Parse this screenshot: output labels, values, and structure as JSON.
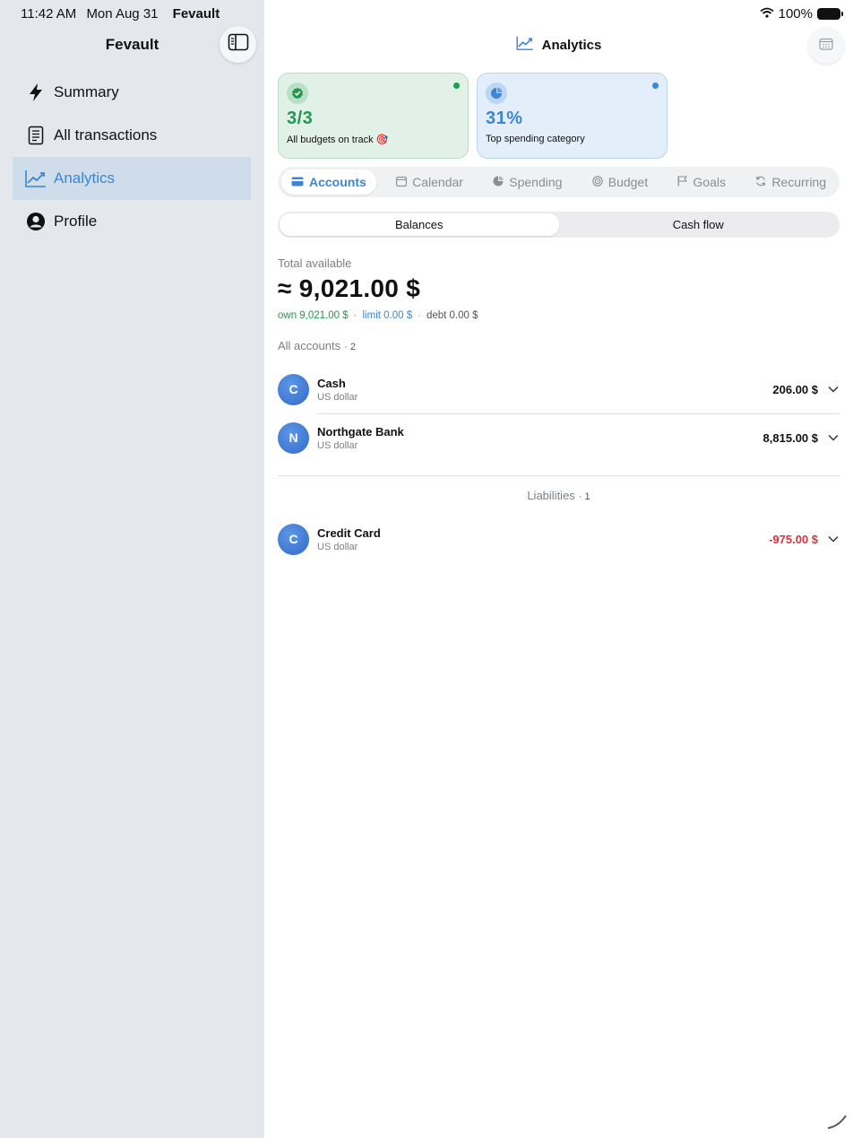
{
  "status": {
    "time": "11:42 AM",
    "date": "Mon Aug 31",
    "app_name": "Fevault",
    "battery": "100%"
  },
  "sidebar": {
    "title": "Fevault",
    "items": [
      {
        "label": "Summary",
        "icon": "bolt-icon"
      },
      {
        "label": "All transactions",
        "icon": "receipt-icon"
      },
      {
        "label": "Analytics",
        "icon": "chart-line-icon",
        "active": true
      },
      {
        "label": "Profile",
        "icon": "person-circle-icon"
      }
    ]
  },
  "header": {
    "title": "Analytics"
  },
  "cards": [
    {
      "value": "3/3",
      "label": "All budgets on track 🎯",
      "icon": "check-badge-icon",
      "color": "#1f9a4d"
    },
    {
      "value": "31%",
      "label": "Top spending category",
      "icon": "pie-chart-icon",
      "color": "#3d86d4"
    }
  ],
  "tabs": [
    {
      "label": "Accounts",
      "icon": "card-icon",
      "active": true
    },
    {
      "label": "Calendar",
      "icon": "calendar-icon"
    },
    {
      "label": "Spending",
      "icon": "pie-icon"
    },
    {
      "label": "Budget",
      "icon": "target-icon"
    },
    {
      "label": "Goals",
      "icon": "flag-icon"
    },
    {
      "label": "Recurring",
      "icon": "repeat-icon"
    }
  ],
  "segments": {
    "balances": "Balances",
    "cash_flow": "Cash flow",
    "selected": "Balances"
  },
  "summary": {
    "total_label": "Total available",
    "total_amount": "≈ 9,021.00 $",
    "own": "own 9,021.00 $",
    "limit": "limit 0.00 $",
    "debt": "debt 0.00 $",
    "separator": "·"
  },
  "accounts_section": {
    "title": "All accounts",
    "count": "· 2"
  },
  "accounts": [
    {
      "initial": "C",
      "name": "Cash",
      "currency": "US dollar",
      "amount": "206.00 $"
    },
    {
      "initial": "N",
      "name": "Northgate Bank",
      "currency": "US dollar",
      "amount": "8,815.00 $"
    }
  ],
  "liabilities_section": {
    "title": "Liabilities",
    "count": "· 1"
  },
  "liabilities": [
    {
      "initial": "C",
      "name": "Credit Card",
      "currency": "US dollar",
      "amount": "-975.00 $"
    }
  ],
  "colors": {
    "accent": "#3d86d4",
    "positive": "#1f9a4d",
    "negative": "#d9303e",
    "sidebar_bg": "#e4e8ec"
  }
}
